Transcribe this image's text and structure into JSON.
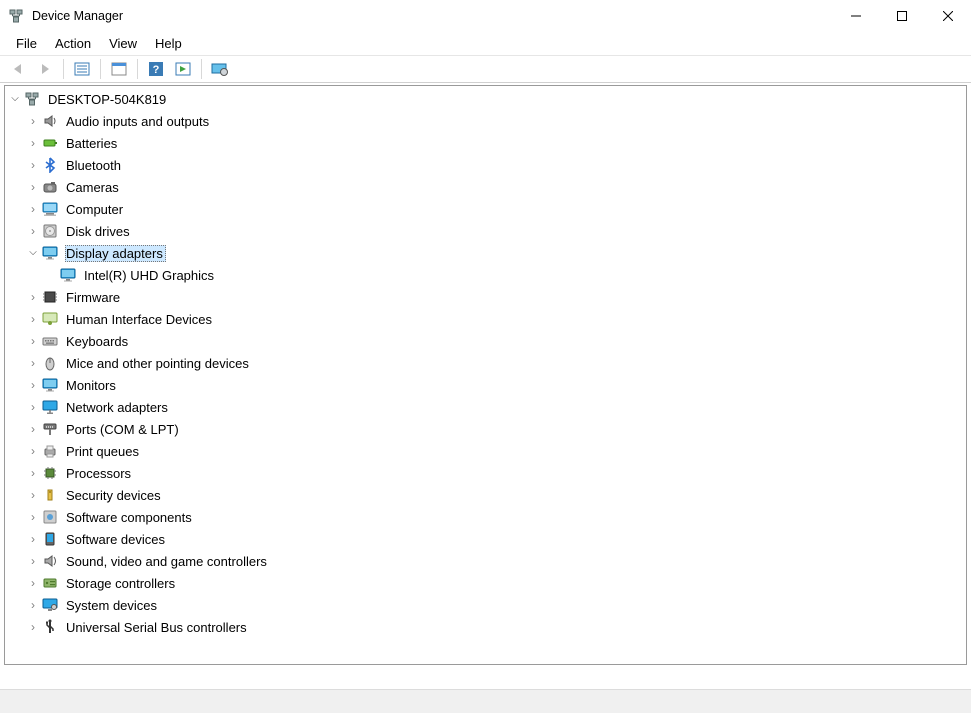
{
  "window": {
    "title": "Device Manager"
  },
  "menus": {
    "file": "File",
    "action": "Action",
    "view": "View",
    "help": "Help"
  },
  "tree": {
    "root": {
      "label": "DESKTOP-504K819"
    },
    "categories": [
      {
        "label": "Audio inputs and outputs",
        "icon": "speaker-icon",
        "expanded": false
      },
      {
        "label": "Batteries",
        "icon": "battery-icon",
        "expanded": false
      },
      {
        "label": "Bluetooth",
        "icon": "bluetooth-icon",
        "expanded": false
      },
      {
        "label": "Cameras",
        "icon": "camera-icon",
        "expanded": false
      },
      {
        "label": "Computer",
        "icon": "computer-icon",
        "expanded": false
      },
      {
        "label": "Disk drives",
        "icon": "disk-icon",
        "expanded": false
      },
      {
        "label": "Display adapters",
        "icon": "display-icon",
        "expanded": true,
        "selected": true,
        "children": [
          {
            "label": "Intel(R) UHD Graphics",
            "icon": "display-icon"
          }
        ]
      },
      {
        "label": "Firmware",
        "icon": "firmware-icon",
        "expanded": false
      },
      {
        "label": "Human Interface Devices",
        "icon": "hid-icon",
        "expanded": false
      },
      {
        "label": "Keyboards",
        "icon": "keyboard-icon",
        "expanded": false
      },
      {
        "label": "Mice and other pointing devices",
        "icon": "mouse-icon",
        "expanded": false
      },
      {
        "label": "Monitors",
        "icon": "monitor-icon",
        "expanded": false
      },
      {
        "label": "Network adapters",
        "icon": "network-icon",
        "expanded": false
      },
      {
        "label": "Ports (COM & LPT)",
        "icon": "port-icon",
        "expanded": false
      },
      {
        "label": "Print queues",
        "icon": "printer-icon",
        "expanded": false
      },
      {
        "label": "Processors",
        "icon": "cpu-icon",
        "expanded": false
      },
      {
        "label": "Security devices",
        "icon": "security-icon",
        "expanded": false
      },
      {
        "label": "Software components",
        "icon": "software-comp-icon",
        "expanded": false
      },
      {
        "label": "Software devices",
        "icon": "software-dev-icon",
        "expanded": false
      },
      {
        "label": "Sound, video and game controllers",
        "icon": "sound-icon",
        "expanded": false
      },
      {
        "label": "Storage controllers",
        "icon": "storage-icon",
        "expanded": false
      },
      {
        "label": "System devices",
        "icon": "system-icon",
        "expanded": false
      },
      {
        "label": "Universal Serial Bus controllers",
        "icon": "usb-icon",
        "expanded": false
      }
    ]
  }
}
